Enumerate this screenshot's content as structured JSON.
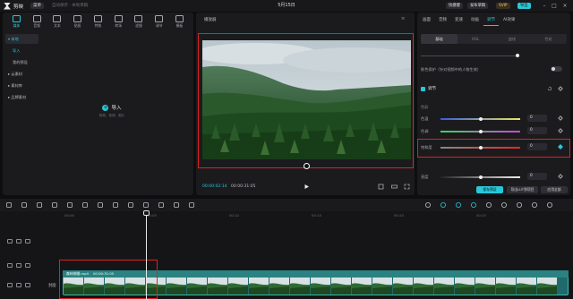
{
  "app": {
    "name": "剪映",
    "menu_label": "菜单",
    "draft_info": "自动保存 · 本地草稿",
    "draft_title": "5月15日",
    "buttons": {
      "shortcuts": "快捷键",
      "publish": "发布草稿",
      "pro": "SVIP",
      "export": "导出"
    }
  },
  "media_tabs": [
    {
      "label": "媒体",
      "icon": "media-icon",
      "active": true
    },
    {
      "label": "音频",
      "icon": "audio-icon",
      "active": false
    },
    {
      "label": "文本",
      "icon": "text-icon",
      "active": false
    },
    {
      "label": "贴纸",
      "icon": "sticker-icon",
      "active": false
    },
    {
      "label": "特效",
      "icon": "effects-icon",
      "active": false
    },
    {
      "label": "转场",
      "icon": "transition-icon",
      "active": false
    },
    {
      "label": "滤镜",
      "icon": "filter-icon",
      "active": false
    },
    {
      "label": "调节",
      "icon": "adjust-icon",
      "active": false
    },
    {
      "label": "模板",
      "icon": "template-icon",
      "active": false
    }
  ],
  "side_nav": [
    {
      "label": "▾ 本地",
      "style": "active"
    },
    {
      "label": "导入",
      "style": "sub blue"
    },
    {
      "label": "我的预设",
      "style": "sub"
    },
    {
      "label": "▸ 云素材",
      "style": ""
    },
    {
      "label": "▸ 素材库",
      "style": ""
    },
    {
      "label": "▸ 品牌素材",
      "style": ""
    }
  ],
  "import": {
    "label": "导入",
    "hint": "视频、音频、图片"
  },
  "player": {
    "title": "播放器",
    "current_time": "00:00:02:14",
    "total_time": "00:00:31:05"
  },
  "props": {
    "tabs": [
      {
        "label": "画面",
        "active": false
      },
      {
        "label": "音频",
        "active": false
      },
      {
        "label": "变速",
        "active": false
      },
      {
        "label": "动画",
        "active": false
      },
      {
        "label": "调节",
        "active": true
      },
      {
        "label": "AI效果",
        "active": false
      }
    ],
    "sub_tabs": [
      {
        "label": "基础",
        "active": true
      },
      {
        "label": "HSL",
        "active": false
      },
      {
        "label": "曲线",
        "active": false
      },
      {
        "label": "色轮",
        "active": false
      }
    ],
    "ai_label": "肤色保护（针对视频中的人物生效）",
    "adjust_title": "调节",
    "section_title": "色彩",
    "rows": [
      {
        "label": "色温",
        "value": "0",
        "knob": 0.5
      },
      {
        "label": "色调",
        "value": "0",
        "knob": 0.5
      },
      {
        "label": "饱和度",
        "value": "0",
        "knob": 0.5
      },
      {
        "label": "亮度",
        "value": "0",
        "knob": 0.5
      }
    ],
    "save_preset": "保存预设",
    "save_lut": "导出LUT到项目",
    "apply_all": "应用全部"
  },
  "timeline": {
    "ticks": [
      "00:00",
      "00:05",
      "00:10",
      "00:15",
      "00:20",
      "00:25"
    ],
    "track_label": "封面",
    "clip_name": "森林俯瞰.mp4",
    "clip_duration": "00:00:31:05"
  },
  "colors": {
    "accent": "#28c8d8",
    "highlight": "#e02020",
    "clip": "#1f6b6b"
  }
}
